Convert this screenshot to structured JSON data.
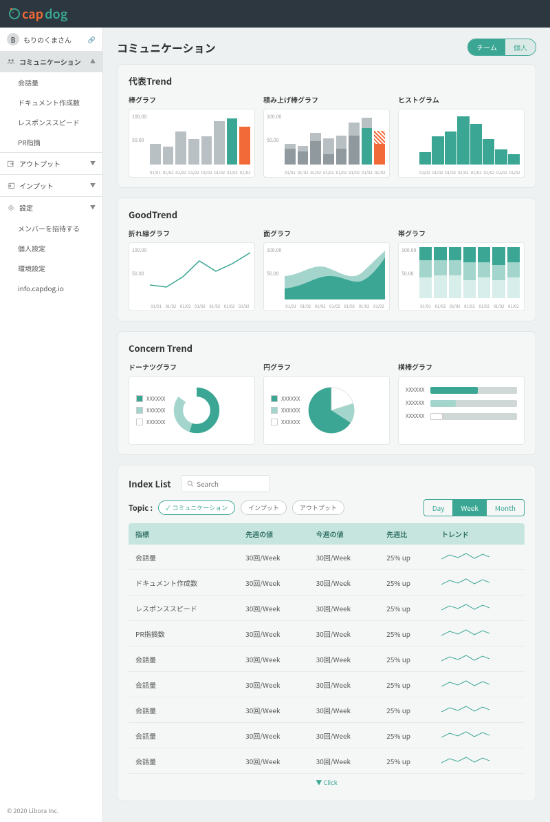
{
  "app": {
    "name_prefix": "cap",
    "name_suffix": "dog"
  },
  "sidebar": {
    "user_initial": "B",
    "user_name": "もりのくまさん",
    "items": [
      {
        "icon": "people",
        "label": "コミュニケーション",
        "active": true
      },
      {
        "sub": true,
        "label": "会話量"
      },
      {
        "sub": true,
        "label": "ドキュメント作成数"
      },
      {
        "sub": true,
        "label": "レスポンススピード"
      },
      {
        "sub": true,
        "label": "PR指摘"
      }
    ],
    "sections": [
      {
        "icon": "output",
        "label": "アウトプット"
      },
      {
        "icon": "input",
        "label": "インプット"
      },
      {
        "icon": "gear",
        "label": "設定",
        "expanded": true
      }
    ],
    "settings_subs": [
      "メンバーを招待する",
      "個人設定",
      "環境設定",
      "info.capdog.io"
    ],
    "copyright": "© 2020 Libora Inc."
  },
  "header": {
    "title": "コミュニケーション",
    "toggle": {
      "team": "チーム",
      "personal": "個人"
    }
  },
  "sections": {
    "trend": "代表Trend",
    "good": "GoodTrend",
    "concern": "Concern Trend",
    "index": "Index List"
  },
  "chart_labels": {
    "bar": "棒グラフ",
    "stacked": "積み上げ棒グラフ",
    "histogram": "ヒストグラム",
    "line": "折れ線グラフ",
    "area": "面グラフ",
    "stacked_bar": "帯グラフ",
    "donut": "ドーナツグラフ",
    "pie": "円グラフ",
    "hbar": "横棒グラフ"
  },
  "legend_label": "XXXXXX",
  "search_placeholder": "Search",
  "topic": {
    "label": "Topic :",
    "chips": [
      "コミュニケーション",
      "インプット",
      "アウトプット"
    ],
    "periods": [
      "Day",
      "Week",
      "Month"
    ]
  },
  "table": {
    "headers": [
      "指標",
      "先週の値",
      "今週の値",
      "先週比",
      "トレンド"
    ],
    "rows": [
      {
        "name": "会話量",
        "prev": "30回/Week",
        "curr": "30回/Week",
        "diff": "25% up"
      },
      {
        "name": "ドキュメント作成数",
        "prev": "30回/Week",
        "curr": "30回/Week",
        "diff": "25% up"
      },
      {
        "name": "レスポンススピード",
        "prev": "30回/Week",
        "curr": "30回/Week",
        "diff": "25% up"
      },
      {
        "name": "PR指摘数",
        "prev": "30回/Week",
        "curr": "30回/Week",
        "diff": "25% up"
      },
      {
        "name": "会話量",
        "prev": "30回/Week",
        "curr": "30回/Week",
        "diff": "25% up"
      },
      {
        "name": "会話量",
        "prev": "30回/Week",
        "curr": "30回/Week",
        "diff": "25% up"
      },
      {
        "name": "会話量",
        "prev": "30回/Week",
        "curr": "30回/Week",
        "diff": "25% up"
      },
      {
        "name": "会話量",
        "prev": "30回/Week",
        "curr": "30回/Week",
        "diff": "25% up"
      },
      {
        "name": "会話量",
        "prev": "30回/Week",
        "curr": "30回/Week",
        "diff": "25% up"
      }
    ],
    "expand": "Click"
  },
  "chart_data": [
    {
      "type": "bar",
      "title": "棒グラフ",
      "categories": [
        "01/01",
        "01/02",
        "01/02",
        "01/02",
        "01/02",
        "01/02",
        "01/02",
        "01/02"
      ],
      "values": [
        40,
        35,
        65,
        50,
        55,
        85,
        90,
        75
      ],
      "ylim": [
        0,
        100
      ],
      "yticks": [
        50,
        100
      ],
      "highlight_index": 6,
      "highlight2_index": 7
    },
    {
      "type": "bar",
      "title": "積み上げ棒グラフ",
      "categories": [
        "01/01",
        "01/02",
        "01/02",
        "01/02",
        "01/02",
        "01/02",
        "01/02",
        "01/02"
      ],
      "series": [
        {
          "name": "base",
          "values": [
            30,
            25,
            45,
            20,
            30,
            55,
            70,
            40
          ]
        },
        {
          "name": "top",
          "values": [
            10,
            10,
            15,
            30,
            25,
            25,
            20,
            25
          ]
        }
      ],
      "ylim": [
        0,
        100
      ],
      "yticks": [
        50,
        100
      ]
    },
    {
      "type": "bar",
      "title": "ヒストグラム",
      "categories": [
        "01/01",
        "01/02",
        "01/02",
        "01/02",
        "01/02",
        "01/02",
        "01/02",
        "01/02"
      ],
      "values": [
        25,
        55,
        65,
        95,
        80,
        50,
        30,
        20
      ],
      "ylim": [
        0,
        100
      ]
    },
    {
      "type": "line",
      "title": "折れ線グラフ",
      "categories": [
        "01/01",
        "01/02",
        "01/02",
        "01/02",
        "01/02",
        "01/02",
        "01/02"
      ],
      "values": [
        30,
        25,
        45,
        75,
        55,
        70,
        90
      ],
      "ylim": [
        0,
        100
      ],
      "yticks": [
        50,
        100
      ]
    },
    {
      "type": "area",
      "title": "面グラフ",
      "categories": [
        "01/01",
        "01/02",
        "01/02",
        "01/02",
        "01/02",
        "01/02",
        "01/02"
      ],
      "series": [
        {
          "name": "light",
          "values": [
            45,
            48,
            70,
            60,
            40,
            55,
            95
          ]
        },
        {
          "name": "dark",
          "values": [
            20,
            22,
            42,
            45,
            25,
            35,
            80
          ]
        }
      ],
      "ylim": [
        0,
        100
      ],
      "yticks": [
        50,
        100
      ]
    },
    {
      "type": "bar",
      "title": "帯グラフ",
      "categories": [
        "01/01",
        "01/02",
        "01/02",
        "01/02",
        "01/02",
        "01/02",
        "01/02"
      ],
      "series": [
        {
          "name": "dark",
          "values": [
            40,
            45,
            45,
            35,
            40,
            35,
            40
          ]
        },
        {
          "name": "mid",
          "values": [
            35,
            30,
            30,
            35,
            30,
            30,
            30
          ]
        },
        {
          "name": "light",
          "values": [
            25,
            25,
            25,
            30,
            30,
            35,
            30
          ]
        }
      ],
      "stacked_100": true,
      "yticks": [
        50,
        100
      ]
    },
    {
      "type": "pie",
      "title": "ドーナツグラフ",
      "donut": true,
      "series": [
        {
          "name": "XXXXXX",
          "value": 55
        },
        {
          "name": "XXXXXX",
          "value": 30
        },
        {
          "name": "XXXXXX",
          "value": 15
        }
      ]
    },
    {
      "type": "pie",
      "title": "円グラフ",
      "series": [
        {
          "name": "XXXXXX",
          "value": 65
        },
        {
          "name": "XXXXXX",
          "value": 20
        },
        {
          "name": "XXXXXX",
          "value": 15
        }
      ]
    },
    {
      "type": "bar",
      "title": "横棒グラフ",
      "horizontal": true,
      "categories": [
        "XXXXXX",
        "XXXXXX",
        "XXXXXX"
      ],
      "values": [
        55,
        30,
        15
      ],
      "xlim": [
        0,
        100
      ]
    }
  ]
}
